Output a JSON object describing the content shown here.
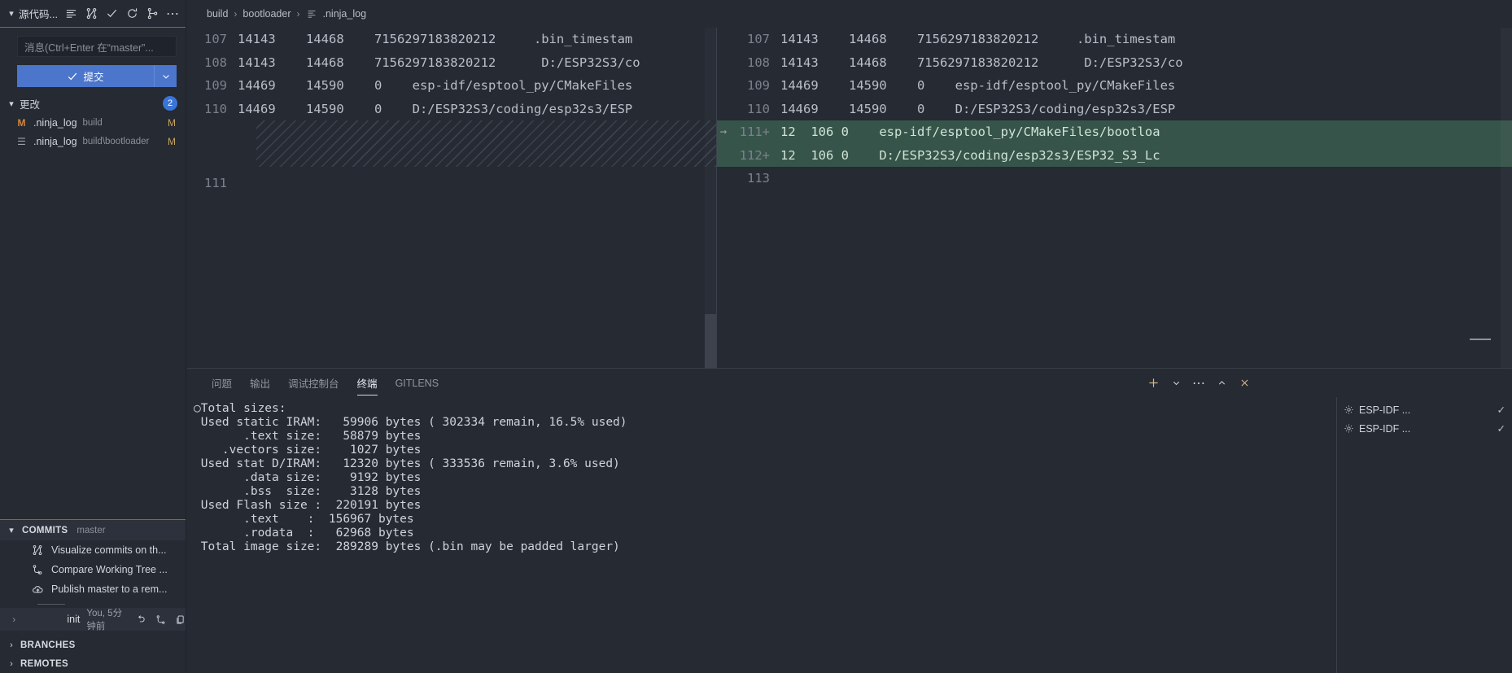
{
  "sidebar": {
    "scm_title": "源代码...",
    "header_icons": [
      "view-as-list-icon",
      "source-control-graph-icon",
      "commit-check-icon",
      "refresh-icon",
      "branch-icon",
      "more-actions-icon"
    ],
    "message_placeholder": "消息(Ctrl+Enter 在“master”...",
    "commit_label": "提交",
    "changes": {
      "label": "更改",
      "count": "2",
      "files": [
        {
          "icon": "modified-file-icon",
          "icon_glyph": "M",
          "name": ".ninja_log",
          "path": "build",
          "status": "M"
        },
        {
          "icon": "log-file-icon",
          "icon_glyph": "☰",
          "name": ".ninja_log",
          "path": "build\\bootloader",
          "status": "M"
        }
      ]
    },
    "commits": {
      "title": "COMMITS",
      "branch": "master",
      "actions": [
        {
          "icon": "commit-graph-icon",
          "label": "Visualize commits on th..."
        },
        {
          "icon": "compare-icon",
          "label": "Compare Working Tree ..."
        },
        {
          "icon": "publish-cloud-icon",
          "label": "Publish master to a rem..."
        }
      ],
      "entry": {
        "expand": "›",
        "message": "init",
        "meta": "You, 5分钟前",
        "icons": [
          "undo-icon",
          "compare-icon",
          "copy-icon"
        ]
      }
    },
    "trees": [
      {
        "label": "BRANCHES"
      },
      {
        "label": "REMOTES"
      }
    ]
  },
  "breadcrumb": {
    "items": [
      "build",
      "bootloader",
      ".ninja_log"
    ],
    "separator": "›",
    "file_icon": "log-file-icon"
  },
  "diff": {
    "left": {
      "lines": [
        {
          "num": "107",
          "text": "14143    14468    7156297183820212     .bin_timestam",
          "type": "context"
        },
        {
          "num": "108",
          "text": "14143    14468    7156297183820212      D:/ESP32S3/co",
          "type": "context"
        },
        {
          "num": "109",
          "text": "14469    14590    0    esp-idf/esptool_py/CMakeFiles",
          "type": "context"
        },
        {
          "num": "110",
          "text": "14469    14590    0    D:/ESP32S3/coding/esp32s3/ESP",
          "type": "context"
        },
        {
          "num": "",
          "text": "",
          "type": "hatch"
        },
        {
          "num": "111",
          "text": "",
          "type": "context"
        }
      ]
    },
    "right": {
      "lines": [
        {
          "num": "107",
          "text": "14143    14468    7156297183820212     .bin_timestam",
          "type": "context",
          "arrow": ""
        },
        {
          "num": "108",
          "text": "14143    14468    7156297183820212      D:/ESP32S3/co",
          "type": "context",
          "arrow": ""
        },
        {
          "num": "109",
          "text": "14469    14590    0    esp-idf/esptool_py/CMakeFiles",
          "type": "context",
          "arrow": ""
        },
        {
          "num": "110",
          "text": "14469    14590    0    D:/ESP32S3/coding/esp32s3/ESP",
          "type": "context",
          "arrow": ""
        },
        {
          "num": "111+",
          "text": "12  106 0    esp-idf/esptool_py/CMakeFiles/bootloa",
          "type": "added",
          "arrow": "→"
        },
        {
          "num": "112+",
          "text": "12  106 0    D:/ESP32S3/coding/esp32s3/ESP32_S3_Lc",
          "type": "added",
          "arrow": ""
        },
        {
          "num": "113",
          "text": "",
          "type": "context",
          "arrow": ""
        }
      ]
    }
  },
  "panel": {
    "tabs": [
      {
        "label": "问题",
        "active": false
      },
      {
        "label": "输出",
        "active": false
      },
      {
        "label": "调试控制台",
        "active": false
      },
      {
        "label": "终端",
        "active": true
      },
      {
        "label": "GITLENS",
        "active": false
      }
    ],
    "actions": [
      {
        "icon": "new-terminal-plus-icon"
      },
      {
        "icon": "chevron-down-icon"
      },
      {
        "icon": "more-actions-icon"
      },
      {
        "icon": "maximize-panel-icon"
      },
      {
        "icon": "close-panel-icon"
      }
    ],
    "terminal_output": "○Total sizes:\n Used static IRAM:   59906 bytes ( 302334 remain, 16.5% used)\n       .text size:   58879 bytes\n    .vectors size:    1027 bytes\n Used stat D/IRAM:   12320 bytes ( 333536 remain, 3.6% used)\n       .data size:    9192 bytes\n       .bss  size:    3128 bytes\n Used Flash size :  220191 bytes\n       .text    :  156967 bytes\n       .rodata  :   62968 bytes\n Total image size:  289289 bytes (.bin may be padded larger)",
    "terminal_tabs": [
      {
        "icon": "terminal-gear-icon",
        "name": "ESP-IDF ...",
        "check": "✓"
      },
      {
        "icon": "terminal-gear-icon",
        "name": "ESP-IDF ...",
        "check": "✓"
      }
    ]
  }
}
